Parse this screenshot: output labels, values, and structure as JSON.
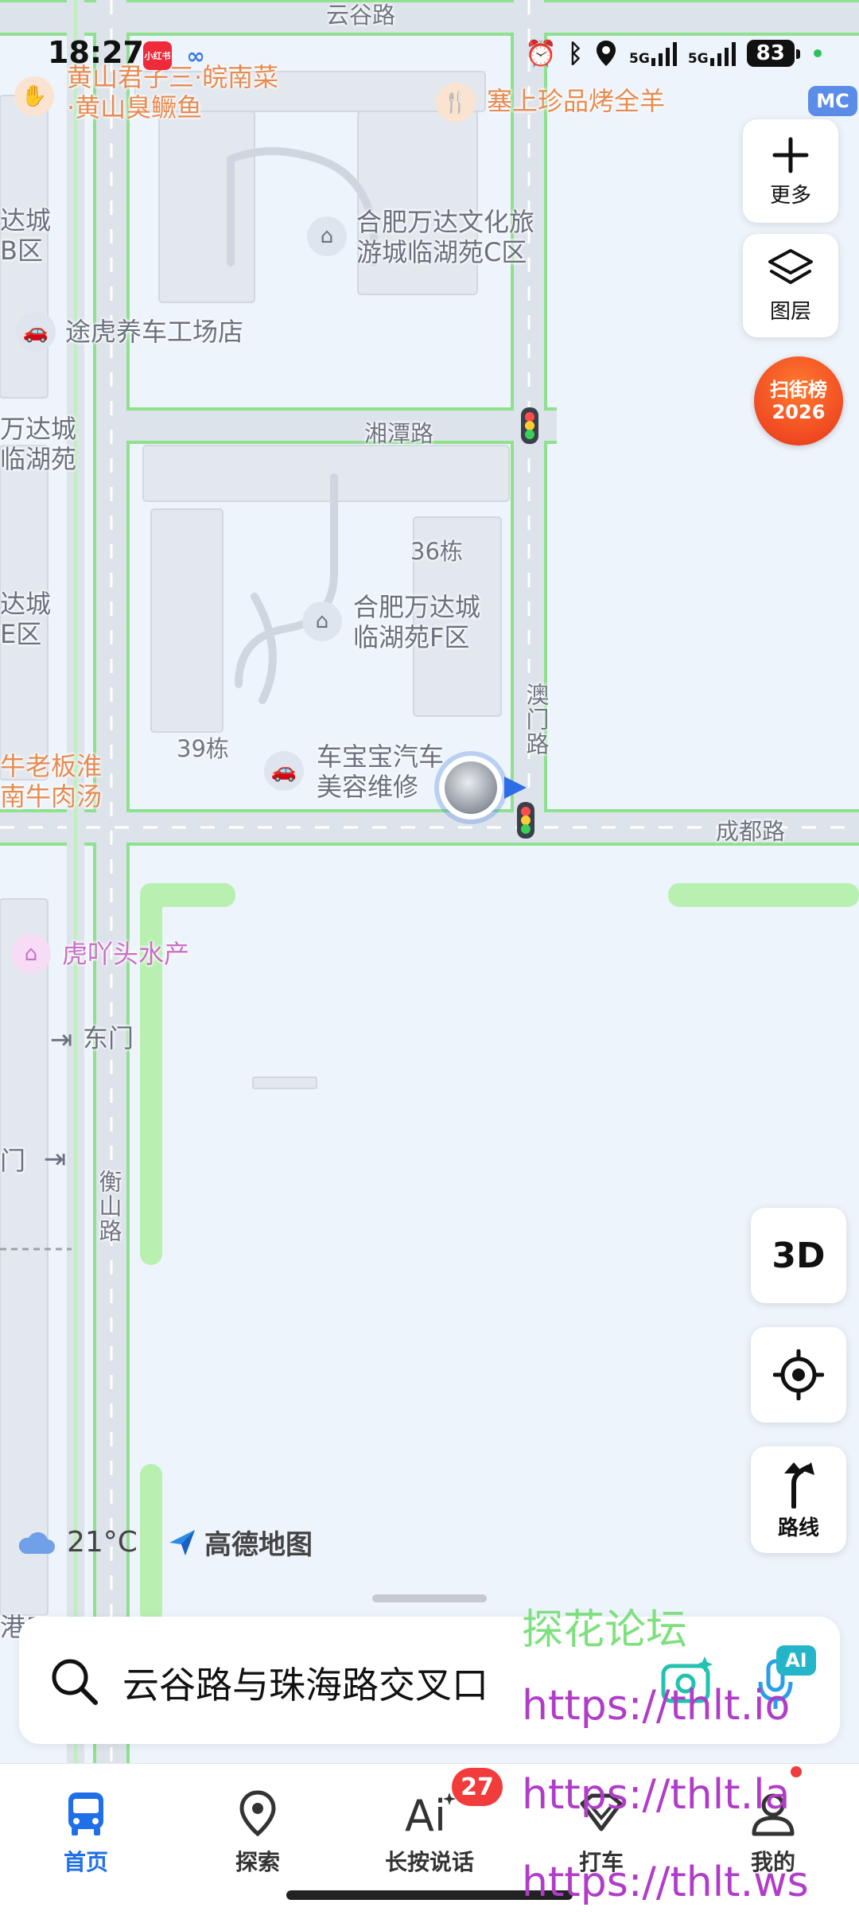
{
  "status_bar": {
    "time": "18:27",
    "app_badge_1": "小红书",
    "network_1": "5G",
    "network_2": "5G",
    "battery": "83"
  },
  "map": {
    "mc_badge": "MC",
    "road_labels": {
      "yungu": "云谷路",
      "xiangtan": "湘潭路",
      "chengdu": "成都路",
      "aomen": "澳门路",
      "hengshan": "衡山路"
    },
    "building_labels": {
      "b36": "36栋",
      "b39": "39栋"
    },
    "pois": {
      "huangshan_line1": "黄山君子三·皖南菜",
      "huangshan_line2": "·黄山臭鳜鱼",
      "saishang": "塞上珍品烤全羊",
      "wanda_c_line1": "合肥万达文化旅",
      "wanda_c_line2": "游城临湖苑C区",
      "tuhu": "途虎养车工场店",
      "wanda_f_line1": "合肥万达城",
      "wanda_f_line2": "临湖苑F区",
      "chebaobao_line1": "车宝宝汽车",
      "chebaobao_line2": "美容维修",
      "niulaoban_line1": "牛老板淮",
      "niulaoban_line2": "南牛肉汤",
      "huyatou": "虎吖头水产",
      "dongmen": "东门",
      "edge_1a": "达城",
      "edge_1b": "B区",
      "edge_2a": "万达城",
      "edge_2b": "临湖苑",
      "edge_3a": "达城",
      "edge_3b": "E区",
      "edge_men": "门",
      "edge_bottom": "港口"
    }
  },
  "controls": {
    "more_label": "更多",
    "layers_label": "图层",
    "scan_line1": "扫街榜",
    "scan_line2": "2026",
    "view_3d": "3D",
    "route_label": "路线"
  },
  "weather": {
    "temperature": "21°C",
    "brand": "高德地图"
  },
  "search": {
    "text": "云谷路与珠海路交叉口",
    "ai_badge": "AI"
  },
  "tabs": [
    {
      "label": "首页"
    },
    {
      "label": "探索"
    },
    {
      "label": "长按说话"
    },
    {
      "label": "打车"
    },
    {
      "label": "我的"
    }
  ],
  "tab_badge": "27",
  "watermarks": {
    "forum": "探花论坛",
    "url1": "https://thlt.io",
    "url2": "https://thlt.la",
    "url3": "https://thlt.ws"
  },
  "colors": {
    "accent": "#1f6fe8",
    "road_outline": "#8fe08f",
    "badge_red": "#f23b3b",
    "scan_orange": "#f04a22"
  }
}
